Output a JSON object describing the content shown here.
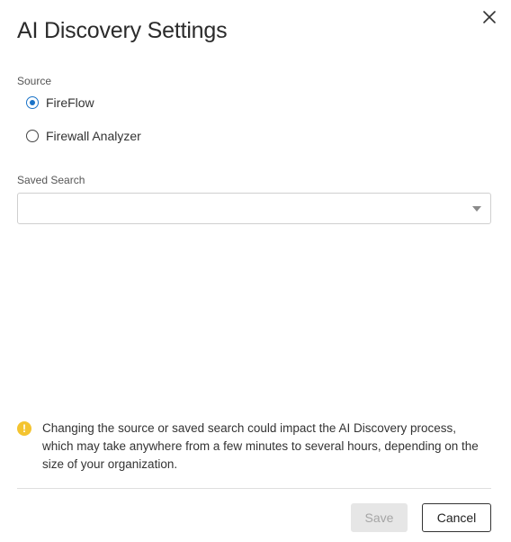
{
  "dialog": {
    "title": "AI Discovery Settings",
    "close_icon": "close-icon"
  },
  "source": {
    "label": "Source",
    "selected": "FireFlow",
    "options": [
      {
        "label": "FireFlow",
        "checked": true
      },
      {
        "label": "Firewall Analyzer",
        "checked": false
      }
    ]
  },
  "saved_search": {
    "label": "Saved Search",
    "value": "",
    "dropdown_icon": "chevron-down-icon"
  },
  "warning": {
    "icon": "warning-icon",
    "icon_glyph": "!",
    "icon_color": "#f4c430",
    "text": "Changing the source or saved search could impact the AI Discovery process, which may take anywhere from a few minutes to several hours, depending on the size of your organization."
  },
  "footer": {
    "save_label": "Save",
    "save_disabled": true,
    "cancel_label": "Cancel"
  },
  "colors": {
    "accent": "#1a73c8",
    "warning": "#f4c430",
    "disabled_bg": "#e6e6e6",
    "disabled_text": "#a5a5a5"
  }
}
